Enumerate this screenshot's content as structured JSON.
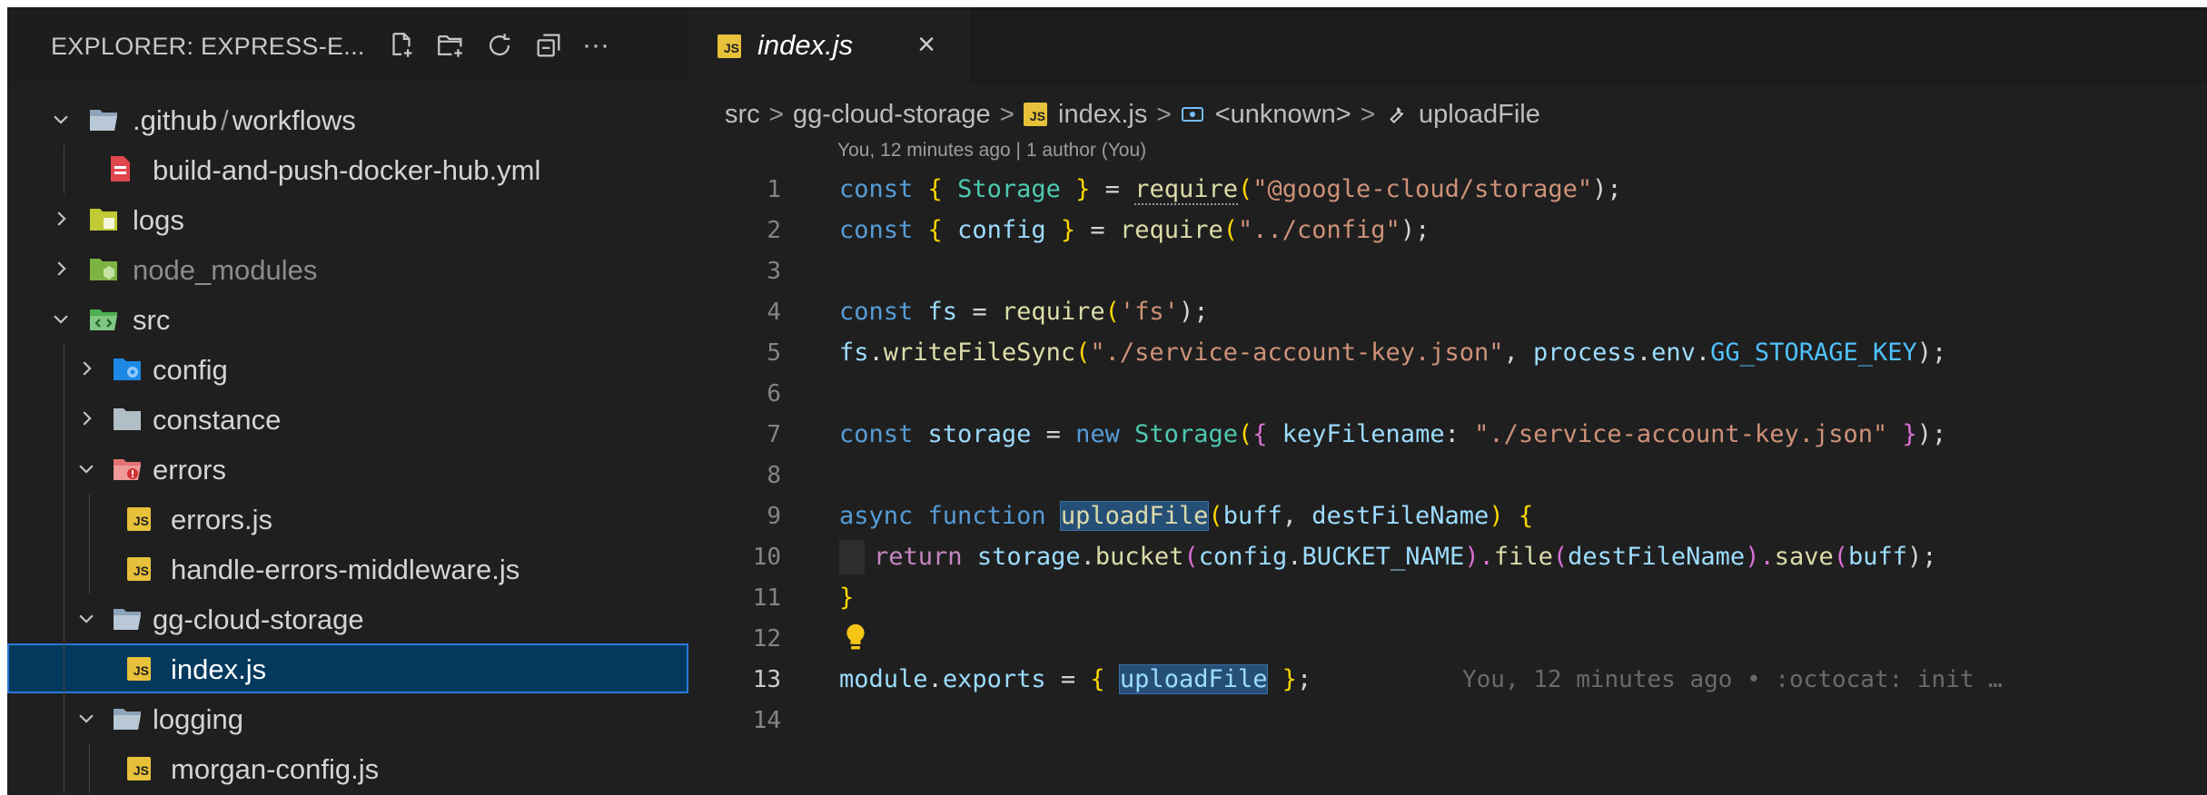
{
  "explorer": {
    "title": "EXPLORER: EXPRESS-E...",
    "actions": [
      "new-file-icon",
      "new-folder-icon",
      "refresh-icon",
      "collapse-all-icon",
      "more-icon"
    ],
    "more_label": "···",
    "items": [
      {
        "label": ".github",
        "label2": "workflows",
        "sep": "/",
        "type": "folder",
        "expanded": true,
        "depth": 0
      },
      {
        "label": "build-and-push-docker-hub.yml",
        "type": "yml",
        "depth": 1
      },
      {
        "label": "logs",
        "type": "folder-logs",
        "expanded": false,
        "depth": 0
      },
      {
        "label": "node_modules",
        "type": "folder-node",
        "expanded": false,
        "depth": 0
      },
      {
        "label": "src",
        "type": "folder-src",
        "expanded": true,
        "depth": 0
      },
      {
        "label": "config",
        "type": "folder-config",
        "expanded": false,
        "depth": 1
      },
      {
        "label": "constance",
        "type": "folder",
        "expanded": false,
        "depth": 1
      },
      {
        "label": "errors",
        "type": "folder-errors",
        "expanded": true,
        "depth": 1
      },
      {
        "label": "errors.js",
        "type": "js",
        "depth": 2
      },
      {
        "label": "handle-errors-middleware.js",
        "type": "js",
        "depth": 2
      },
      {
        "label": "gg-cloud-storage",
        "type": "folder",
        "expanded": true,
        "depth": 1
      },
      {
        "label": "index.js",
        "type": "js",
        "depth": 2,
        "selected": true
      },
      {
        "label": "logging",
        "type": "folder",
        "expanded": true,
        "depth": 1
      },
      {
        "label": "morgan-config.js",
        "type": "js",
        "depth": 2
      }
    ]
  },
  "tab": {
    "label": "index.js",
    "badge": "JS",
    "close": "×"
  },
  "breadcrumb": {
    "parts": [
      "src",
      "gg-cloud-storage",
      "index.js",
      "<unknown>",
      "uploadFile"
    ],
    "sep": ">"
  },
  "blame_header": "You, 12 minutes ago | 1 author (You)",
  "code": {
    "active_line": 13,
    "inline_blame": "You, 12 minutes ago • :octocat: init …",
    "lines": [
      {
        "n": "1"
      },
      {
        "n": "2"
      },
      {
        "n": "3"
      },
      {
        "n": "4"
      },
      {
        "n": "5"
      },
      {
        "n": "6"
      },
      {
        "n": "7"
      },
      {
        "n": "8"
      },
      {
        "n": "9"
      },
      {
        "n": "10"
      },
      {
        "n": "11"
      },
      {
        "n": "12"
      },
      {
        "n": "13"
      },
      {
        "n": "14"
      }
    ],
    "tokens": {
      "l1": [
        "const",
        " ",
        "{",
        " ",
        "Storage",
        " ",
        "}",
        " = ",
        "require",
        "(",
        "\"@google-cloud/storage\"",
        ");"
      ],
      "l2": [
        "const",
        " ",
        "{",
        " ",
        "config",
        " ",
        "}",
        " = ",
        "require",
        "(",
        "\"../config\"",
        ");"
      ],
      "l4": [
        "const",
        " ",
        "fs",
        " = ",
        "require",
        "(",
        "'fs'",
        ");"
      ],
      "l5": [
        "fs",
        ".",
        "writeFileSync",
        "(",
        "\"./service-account-key.json\"",
        ", ",
        "process",
        ".",
        "env",
        ".",
        "GG_STORAGE_KEY",
        ");"
      ],
      "l7": [
        "const",
        " ",
        "storage",
        " = ",
        "new",
        " ",
        "Storage",
        "(",
        "{",
        " ",
        "keyFilename",
        ": ",
        "\"./service-account-key.json\"",
        " ",
        "}",
        ");"
      ],
      "l9": [
        "async",
        " ",
        "function",
        " ",
        "uploadFile",
        "(",
        "buff",
        ", ",
        "destFileName",
        ") ",
        "{"
      ],
      "l10": [
        "return",
        " ",
        "storage",
        ".",
        "bucket",
        "(",
        "config",
        ".",
        "BUCKET_NAME",
        ").",
        "file",
        "(",
        "destFileName",
        ").",
        "save",
        "(",
        "buff",
        ");"
      ],
      "l11": [
        "}"
      ],
      "l13": [
        "module",
        ".",
        "exports",
        " = ",
        "{",
        " ",
        "uploadFile",
        " ",
        "}",
        ";"
      ]
    }
  },
  "colors": {
    "background": "#1f1f1f",
    "selection": "#04395e",
    "js_badge": "#e8c13a",
    "keyword": "#569cd6",
    "string": "#ce9178",
    "function": "#dcdcaa",
    "variable": "#9cdcfe",
    "type": "#4ec9b0"
  }
}
